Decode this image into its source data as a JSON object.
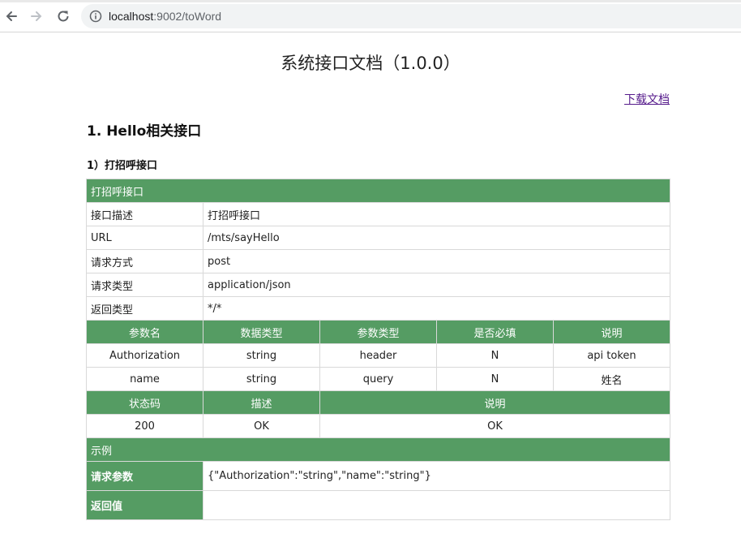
{
  "browser": {
    "url_host": "localhost",
    "url_rest": ":9002/toWord"
  },
  "doc": {
    "title": "系统接口文档（1.0.0）",
    "download_label": "下载文档",
    "section_title": "1. Hello相关接口",
    "sub_title": "1）打招呼接口"
  },
  "api": {
    "header": "打招呼接口",
    "info_rows": [
      {
        "label": "接口描述",
        "value": "打招呼接口"
      },
      {
        "label": "URL",
        "value": "/mts/sayHello"
      },
      {
        "label": "请求方式",
        "value": "post"
      },
      {
        "label": "请求类型",
        "value": "application/json"
      },
      {
        "label": "返回类型",
        "value": "*/*"
      }
    ],
    "param_headers": [
      "参数名",
      "数据类型",
      "参数类型",
      "是否必填",
      "说明"
    ],
    "params": [
      [
        "Authorization",
        "string",
        "header",
        "N",
        "api token"
      ],
      [
        "name",
        "string",
        "query",
        "N",
        "姓名"
      ]
    ],
    "status_headers": [
      "状态码",
      "描述",
      "说明"
    ],
    "statuses": [
      [
        "200",
        "OK",
        "OK"
      ]
    ],
    "example_header": "示例",
    "request_label": "请求参数",
    "request_value": "{\"Authorization\":\"string\",\"name\":\"string\"}",
    "response_label": "返回值",
    "response_value": ""
  }
}
